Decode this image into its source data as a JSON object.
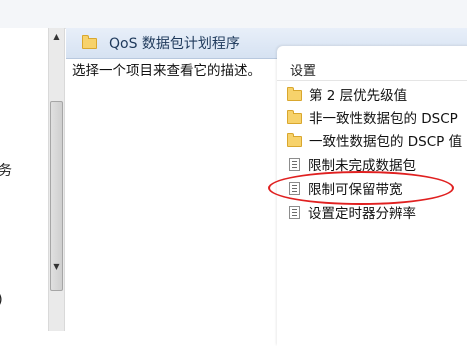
{
  "left_pane": {
    "partial_items": [
      "务",
      "s)"
    ]
  },
  "header": {
    "title": "QoS 数据包计划程序",
    "icon": "folder-icon"
  },
  "description": {
    "text": "选择一个项目来查看它的描述。"
  },
  "settings_list": {
    "column_header": "设置",
    "items": [
      {
        "label": "第 2 层优先级值",
        "icon": "folder-icon"
      },
      {
        "label": "非一致性数据包的 DSCP",
        "icon": "folder-icon"
      },
      {
        "label": "一致性数据包的 DSCP 值",
        "icon": "folder-icon"
      },
      {
        "label": "限制未完成数据包",
        "icon": "policy-document-icon"
      },
      {
        "label": "限制可保留带宽",
        "icon": "policy-document-icon"
      },
      {
        "label": "设置定时器分辨率",
        "icon": "policy-document-icon"
      }
    ]
  },
  "annotation": {
    "color": "#e02020",
    "target": "限制可保留带宽"
  }
}
